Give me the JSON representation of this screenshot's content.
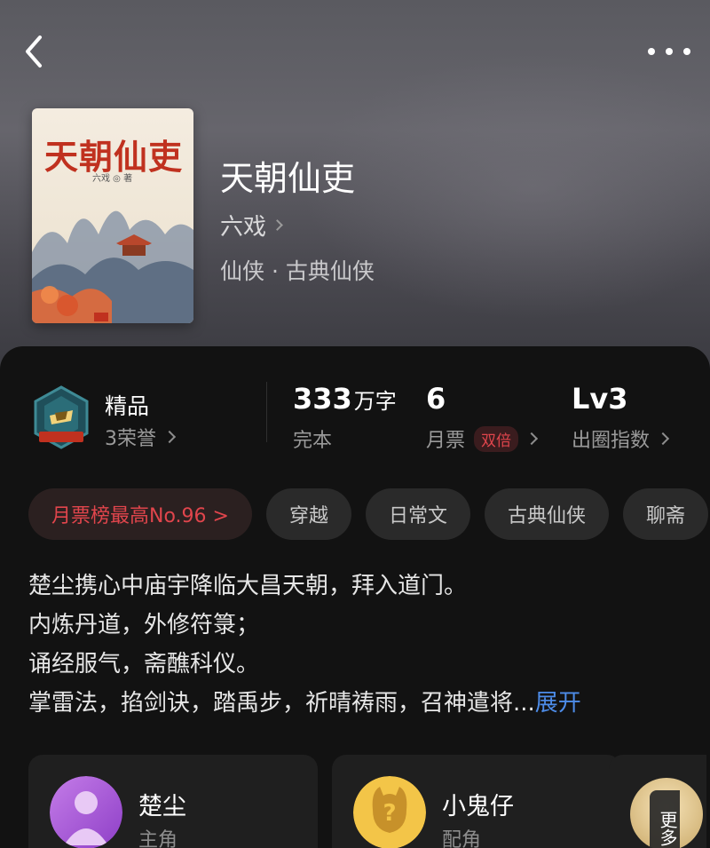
{
  "header": {
    "back_icon": "chevron-left-icon",
    "more_icon": "more-horizontal-icon"
  },
  "book": {
    "cover_title": "天朝仙吏",
    "cover_author": "六戏 ◎ 著",
    "title": "天朝仙吏",
    "author": "六戏",
    "genre": "仙侠 · 古典仙侠"
  },
  "stats": {
    "honor_title": "精品",
    "honor_sub": "3荣誉",
    "word_count": "333",
    "word_unit": "万字",
    "status": "完本",
    "monthly_votes": "6",
    "monthly_label": "月票",
    "double_tag": "双倍",
    "level": "Lv3",
    "level_label": "出圈指数"
  },
  "tags": [
    "月票榜最高No.96 >",
    "穿越",
    "日常文",
    "古典仙侠",
    "聊斋"
  ],
  "description": {
    "lines": [
      "楚尘携心中庙宇降临大昌天朝，拜入道门。",
      "内炼丹道，外修符箓；",
      "诵经服气，斋醮科仪。",
      "掌雷法，掐剑诀，踏禹步，祈晴祷雨，召神遣将..."
    ],
    "expand_label": "展开"
  },
  "characters": [
    {
      "name": "楚尘",
      "role": "主角"
    },
    {
      "name": "小鬼仔",
      "role": "配角"
    }
  ],
  "more_characters_label": "更多",
  "colors": {
    "accent_red": "#e0454c",
    "link_blue": "#4d8ce8",
    "panel_bg": "#121212"
  }
}
